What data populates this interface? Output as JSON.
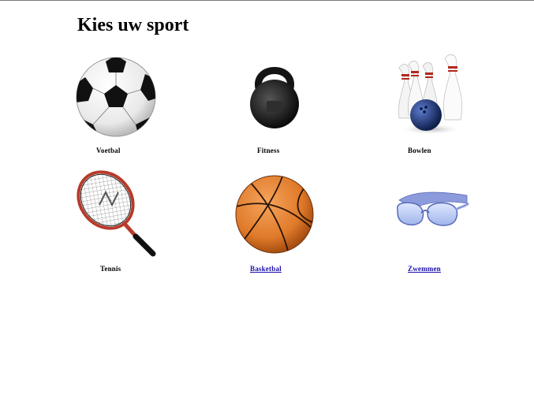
{
  "page": {
    "title": "Kies uw sport"
  },
  "sports": [
    {
      "label": "Voetbal",
      "icon": "soccer-ball-icon",
      "link": false
    },
    {
      "label": "Fitness",
      "icon": "kettlebell-icon",
      "link": false
    },
    {
      "label": "Bowlen",
      "icon": "bowling-icon",
      "link": false
    },
    {
      "label": "Tennis",
      "icon": "tennis-racket-icon",
      "link": false
    },
    {
      "label": "Basketbal",
      "icon": "basketball-icon",
      "link": true
    },
    {
      "label": "Zwemmen",
      "icon": "swim-goggles-icon",
      "link": true
    }
  ],
  "colors": {
    "link": "#1a0dab",
    "basketball": "#e07a2a",
    "bowling_ball": "#1f3a7a",
    "goggles": "#7b8fd6",
    "racket": "#b83a2a"
  }
}
